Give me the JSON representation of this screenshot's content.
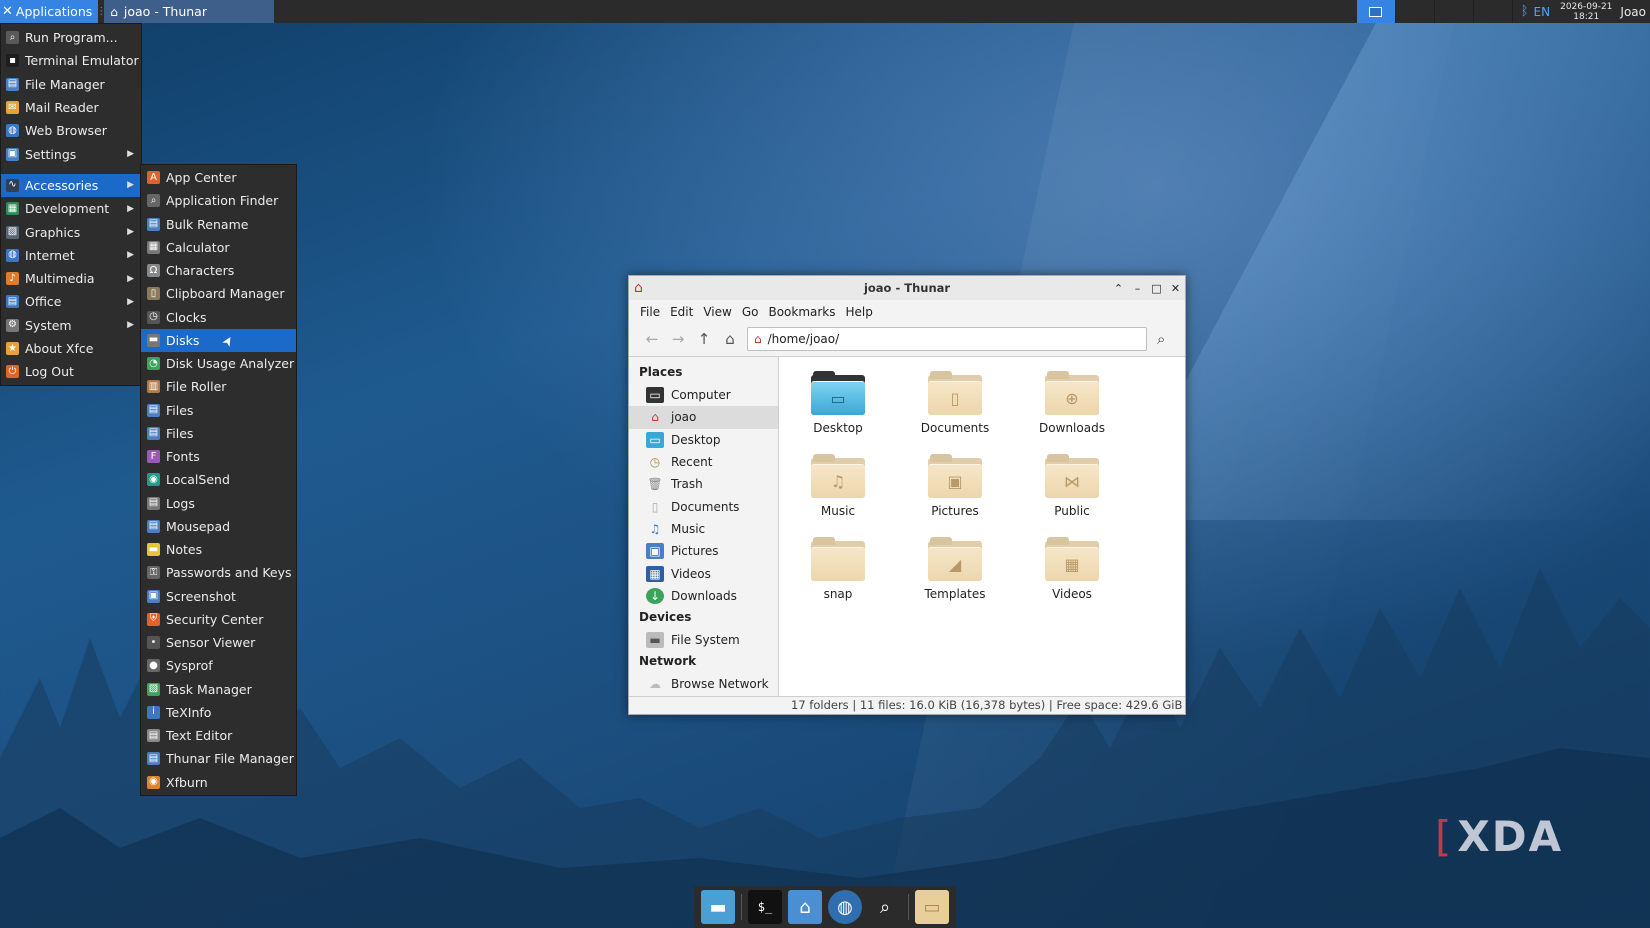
{
  "top_panel": {
    "applications_label": "Applications",
    "task_title": "joao - Thunar",
    "lang": "EN",
    "date": "2026-09-21",
    "time": "18:21",
    "user": "Joao"
  },
  "app_menu": {
    "items": [
      {
        "label": "Run Program...",
        "icon": "run-icon",
        "color": "#5a5a5a"
      },
      {
        "label": "Terminal Emulator",
        "icon": "terminal-icon",
        "color": "#1e1e1e"
      },
      {
        "label": "File Manager",
        "icon": "file-manager-icon",
        "color": "#4a7fc1"
      },
      {
        "label": "Mail Reader",
        "icon": "mail-icon",
        "color": "#e0a43a"
      },
      {
        "label": "Web Browser",
        "icon": "globe-icon",
        "color": "#3b78c4"
      },
      {
        "label": "Settings",
        "icon": "settings-icon",
        "color": "#4a7fc1"
      },
      {
        "label": "Accessories",
        "icon": "accessories-icon",
        "color": "#2f3f55"
      },
      {
        "label": "Development",
        "icon": "development-icon",
        "color": "#2e8b57"
      },
      {
        "label": "Graphics",
        "icon": "graphics-icon",
        "color": "#556677"
      },
      {
        "label": "Internet",
        "icon": "internet-icon",
        "color": "#3b78c4"
      },
      {
        "label": "Multimedia",
        "icon": "multimedia-icon",
        "color": "#e07b2a"
      },
      {
        "label": "Office",
        "icon": "office-icon",
        "color": "#3b78c4"
      },
      {
        "label": "System",
        "icon": "gear-icon",
        "color": "#777777"
      },
      {
        "label": "About Xfce",
        "icon": "star-icon",
        "color": "#e0a43a"
      },
      {
        "label": "Log Out",
        "icon": "logout-icon",
        "color": "#e0642a"
      }
    ]
  },
  "accessories_menu": {
    "items": [
      {
        "label": "App Center",
        "icon": "app-center-icon",
        "color": "#e0642a"
      },
      {
        "label": "Application Finder",
        "icon": "app-finder-icon",
        "color": "#666666"
      },
      {
        "label": "Bulk Rename",
        "icon": "bulk-rename-icon",
        "color": "#4a7fc1"
      },
      {
        "label": "Calculator",
        "icon": "calculator-icon",
        "color": "#777777"
      },
      {
        "label": "Characters",
        "icon": "characters-icon",
        "color": "#888888"
      },
      {
        "label": "Clipboard Manager",
        "icon": "clipboard-icon",
        "color": "#8a7a5a"
      },
      {
        "label": "Clocks",
        "icon": "clock-icon",
        "color": "#555555"
      },
      {
        "label": "Disks",
        "icon": "disks-icon",
        "color": "#777777"
      },
      {
        "label": "Disk Usage Analyzer",
        "icon": "disk-usage-icon",
        "color": "#3aa35c"
      },
      {
        "label": "File Roller",
        "icon": "file-roller-icon",
        "color": "#b07a4a"
      },
      {
        "label": "Files",
        "icon": "files-icon",
        "color": "#4a7fc1"
      },
      {
        "label": "Files",
        "icon": "files-icon",
        "color": "#4a7fc1"
      },
      {
        "label": "Fonts",
        "icon": "fonts-icon",
        "color": "#9b59b6"
      },
      {
        "label": "LocalSend",
        "icon": "localsend-icon",
        "color": "#1e9e8a"
      },
      {
        "label": "Logs",
        "icon": "logs-icon",
        "color": "#777777"
      },
      {
        "label": "Mousepad",
        "icon": "mousepad-icon",
        "color": "#4a7fc1"
      },
      {
        "label": "Notes",
        "icon": "notes-icon",
        "color": "#e6c43a"
      },
      {
        "label": "Passwords and Keys",
        "icon": "keys-icon",
        "color": "#666666"
      },
      {
        "label": "Screenshot",
        "icon": "screenshot-icon",
        "color": "#4a7fc1"
      },
      {
        "label": "Security Center",
        "icon": "shield-icon",
        "color": "#e0642a"
      },
      {
        "label": "Sensor Viewer",
        "icon": "sensor-icon",
        "color": "#555555"
      },
      {
        "label": "Sysprof",
        "icon": "sysprof-icon",
        "color": "#666666"
      },
      {
        "label": "Task Manager",
        "icon": "task-manager-icon",
        "color": "#3aa35c"
      },
      {
        "label": "TeXInfo",
        "icon": "info-icon",
        "color": "#3b78c4"
      },
      {
        "label": "Text Editor",
        "icon": "text-editor-icon",
        "color": "#888888"
      },
      {
        "label": "Thunar File Manager",
        "icon": "thunar-icon",
        "color": "#4a7fc1"
      },
      {
        "label": "Xfburn",
        "icon": "xfburn-icon",
        "color": "#e0842a"
      }
    ]
  },
  "thunar": {
    "title": "joao - Thunar",
    "menubar": [
      "File",
      "Edit",
      "View",
      "Go",
      "Bookmarks",
      "Help"
    ],
    "path": "/home/joao/",
    "sidebar": {
      "places_label": "Places",
      "places": [
        "Computer",
        "joao",
        "Desktop",
        "Recent",
        "Trash",
        "Documents",
        "Music",
        "Pictures",
        "Videos",
        "Downloads"
      ],
      "devices_label": "Devices",
      "devices": [
        "File System"
      ],
      "network_label": "Network",
      "network": [
        "Browse Network"
      ]
    },
    "files": [
      "Desktop",
      "Documents",
      "Downloads",
      "Music",
      "Pictures",
      "Public",
      "snap",
      "Templates",
      "Videos"
    ],
    "status": "17 folders  |  11 files: 16.0 KiB (16,378 bytes)  |  Free space: 429.6 GiB"
  },
  "watermark": "XDA"
}
